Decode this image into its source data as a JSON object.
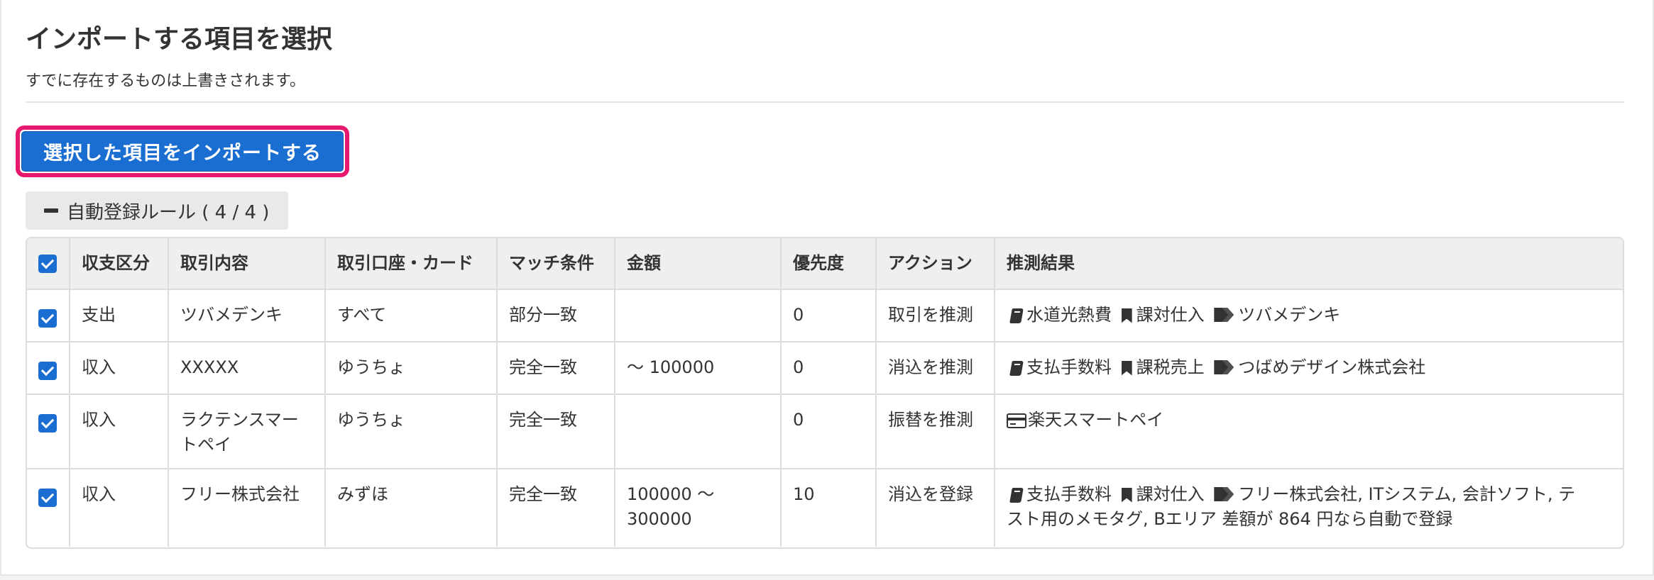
{
  "header": {
    "title": "インポートする項目を選択",
    "subtitle": "すでに存在するものは上書きされます。"
  },
  "import_button": {
    "label": "選択した項目をインポートする"
  },
  "rule_toggle": {
    "label": "自動登録ルール ( 4 / 4 )",
    "icon": "minus-icon"
  },
  "table": {
    "headers": {
      "type": "収支区分",
      "content": "取引内容",
      "account": "取引口座・カード",
      "match": "マッチ条件",
      "amount": "金額",
      "priority": "優先度",
      "action": "アクション",
      "result": "推測結果"
    },
    "rows": [
      {
        "checked": true,
        "type": "支出",
        "content": "ツバメデンキ",
        "account": "すべて",
        "match": "部分一致",
        "amount": "",
        "priority": "0",
        "action": "取引を推測",
        "result": {
          "account_item": "水道光熱費",
          "tax": "課対仕入",
          "tags": "ツバメデンキ"
        }
      },
      {
        "checked": true,
        "type": "収入",
        "content": "XXXXX",
        "account": "ゆうちょ",
        "match": "完全一致",
        "amount": "〜 100000",
        "priority": "0",
        "action": "消込を推測",
        "result": {
          "account_item": "支払手数料",
          "tax": "課税売上",
          "tags": "つばめデザイン株式会社"
        }
      },
      {
        "checked": true,
        "type": "収入",
        "content_line1": "ラクテンスマー",
        "content_line2": "トペイ",
        "account": "ゆうちょ",
        "match": "完全一致",
        "amount": "",
        "priority": "0",
        "action": "振替を推測",
        "result": {
          "wallet": "楽天スマートペイ"
        }
      },
      {
        "checked": true,
        "type": "収入",
        "content": "フリー株式会社",
        "account": "みずほ",
        "match": "完全一致",
        "amount_line1": "100000 〜",
        "amount_line2": "300000",
        "priority": "10",
        "action": "消込を登録",
        "result": {
          "account_item": "支払手数料",
          "tax": "課対仕入",
          "tags_line1": "フリー株式会社, ITシステム, 会計ソフト, テ",
          "tags_line2": "スト用のメモタグ, Bエリア 差額が 864 円なら自動で登録"
        }
      }
    ]
  },
  "colors": {
    "primary": "#1a6ed1",
    "highlight_border": "#e6196e",
    "header_bg": "#efefef"
  }
}
